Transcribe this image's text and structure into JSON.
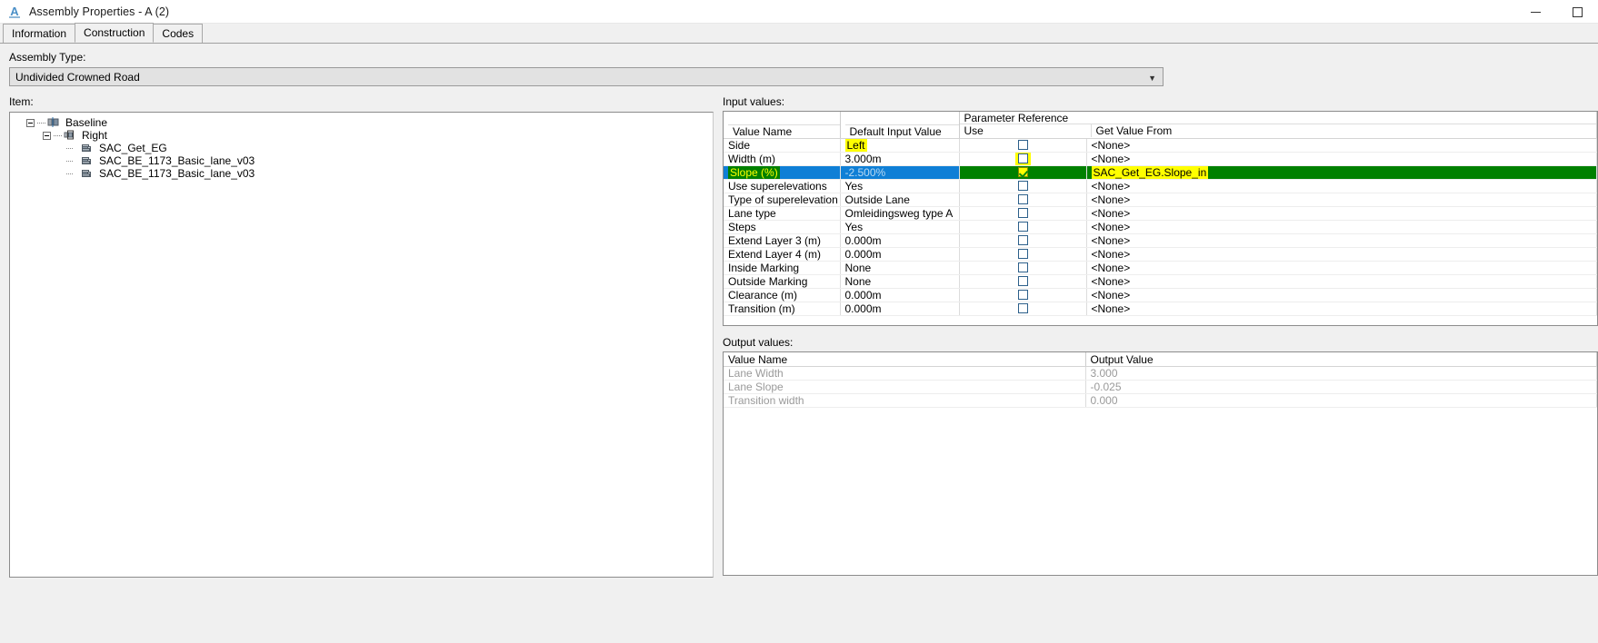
{
  "window": {
    "title": "Assembly Properties - A (2)",
    "app_icon": "autocad-a-icon",
    "controls": {
      "minimize": "minimize-icon",
      "maximize": "maximize-icon"
    }
  },
  "tabs": [
    {
      "label": "Information",
      "active": false
    },
    {
      "label": "Construction",
      "active": true
    },
    {
      "label": "Codes",
      "active": false
    }
  ],
  "assembly": {
    "label": "Assembly Type:",
    "value": "Undivided Crowned Road",
    "arrow": "chevron-down-icon"
  },
  "item": {
    "label": "Item:",
    "tree": [
      {
        "level": 0,
        "label": "Baseline",
        "icon": "baseline-icon",
        "expander": true
      },
      {
        "level": 1,
        "label": "Right",
        "icon": "group-icon",
        "expander": true
      },
      {
        "level": 2,
        "label": "SAC_Get_EG",
        "icon": "subassembly-icon",
        "expander": false
      },
      {
        "level": 2,
        "label": "SAC_BE_1173_Basic_lane_v03",
        "icon": "subassembly-icon",
        "expander": false
      },
      {
        "level": 2,
        "label": "SAC_BE_1173_Basic_lane_v03",
        "icon": "subassembly-icon",
        "expander": false
      }
    ]
  },
  "input": {
    "label": "Input values:",
    "headers": {
      "value_name": "Value Name",
      "default_input_value": "Default Input Value",
      "parameter_reference": "Parameter Reference",
      "use": "Use",
      "get_value_from": "Get Value From"
    },
    "none_text": "<None>",
    "rows": [
      {
        "name": "Side",
        "value": "Left",
        "use": false,
        "source": "<None>",
        "selected": false,
        "name_highlight": "none",
        "value_highlight": "yellow",
        "source_highlight": "none"
      },
      {
        "name": "Width (m)",
        "value": "3.000m",
        "use": false,
        "source": "<None>",
        "selected": false,
        "name_highlight": "none",
        "value_highlight": "none",
        "source_highlight": "none"
      },
      {
        "name": "Slope (%)",
        "value": "-2.500%",
        "use": true,
        "source": "SAC_Get_EG.Slope_in",
        "selected": true,
        "name_highlight": "green",
        "value_highlight": "none",
        "source_highlight": "green-yellow"
      },
      {
        "name": "Use superelevations",
        "value": "Yes",
        "use": false,
        "source": "<None>",
        "selected": false
      },
      {
        "name": "Type of superelevation",
        "value": "Outside Lane",
        "use": false,
        "source": "<None>",
        "selected": false
      },
      {
        "name": "Lane type",
        "value": "Omleidingsweg type A",
        "use": false,
        "source": "<None>",
        "selected": false
      },
      {
        "name": "Steps",
        "value": "Yes",
        "use": false,
        "source": "<None>",
        "selected": false
      },
      {
        "name": "Extend Layer 3 (m)",
        "value": "0.000m",
        "use": false,
        "source": "<None>",
        "selected": false
      },
      {
        "name": "Extend Layer 4 (m)",
        "value": "0.000m",
        "use": false,
        "source": "<None>",
        "selected": false
      },
      {
        "name": "Inside Marking",
        "value": "None",
        "use": false,
        "source": "<None>",
        "selected": false
      },
      {
        "name": "Outside Marking",
        "value": "None",
        "use": false,
        "source": "<None>",
        "selected": false
      },
      {
        "name": "Clearance (m)",
        "value": "0.000m",
        "use": false,
        "source": "<None>",
        "selected": false
      },
      {
        "name": "Transition (m)",
        "value": "0.000m",
        "use": false,
        "source": "<None>",
        "selected": false
      }
    ]
  },
  "output": {
    "label": "Output values:",
    "headers": {
      "value_name": "Value Name",
      "output_value": "Output Value"
    },
    "rows": [
      {
        "name": "Lane Width",
        "value": "3.000"
      },
      {
        "name": "Lane Slope",
        "value": "-0.025"
      },
      {
        "name": "Transition width",
        "value": "0.000"
      }
    ]
  },
  "colors": {
    "selection_blue": "#0f7fd6",
    "marker_yellow": "#ffff00",
    "marker_green": "#008000",
    "window_bg": "#f0f0f0"
  }
}
